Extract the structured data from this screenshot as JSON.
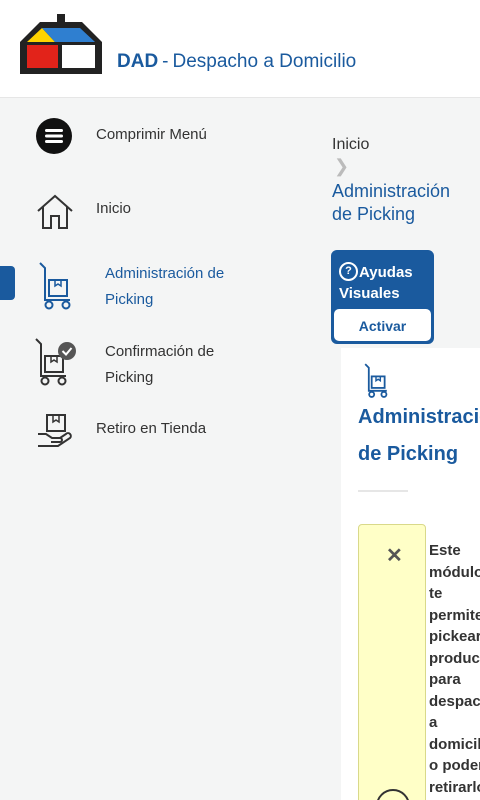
{
  "header": {
    "app_name": "DAD",
    "separator": "-",
    "app_subtitle": "Despacho a Domicilio",
    "logo_colors": {
      "black": "#222222",
      "yellow": "#ffd400",
      "blue": "#2f7fd0",
      "red": "#e2231a"
    }
  },
  "sidebar": {
    "collapse_label": "Comprimir Menú",
    "items": [
      {
        "label": "Inicio",
        "icon": "home-icon"
      },
      {
        "label": "Administración de Picking",
        "icon": "picking-cart-icon",
        "active": true
      },
      {
        "label": "Confirmación de Picking",
        "icon": "picking-confirm-icon"
      },
      {
        "label": "Retiro en Tienda",
        "icon": "store-pickup-icon"
      }
    ]
  },
  "main": {
    "breadcrumb": {
      "home": "Inicio",
      "current": "Administración de Picking"
    },
    "help": {
      "title": "Ayudas Visuales",
      "button_label": "Activar"
    },
    "card": {
      "title": "Administración de Picking",
      "tip_text": "Este módulo te permite pickear productos para despacho a domicilio o poder retirarlos en tienda. También podrá"
    }
  },
  "colors": {
    "accent": "#1a5a9e",
    "sidebar_bg": "#f4f5f5",
    "tip_bg": "#ffffc7"
  }
}
